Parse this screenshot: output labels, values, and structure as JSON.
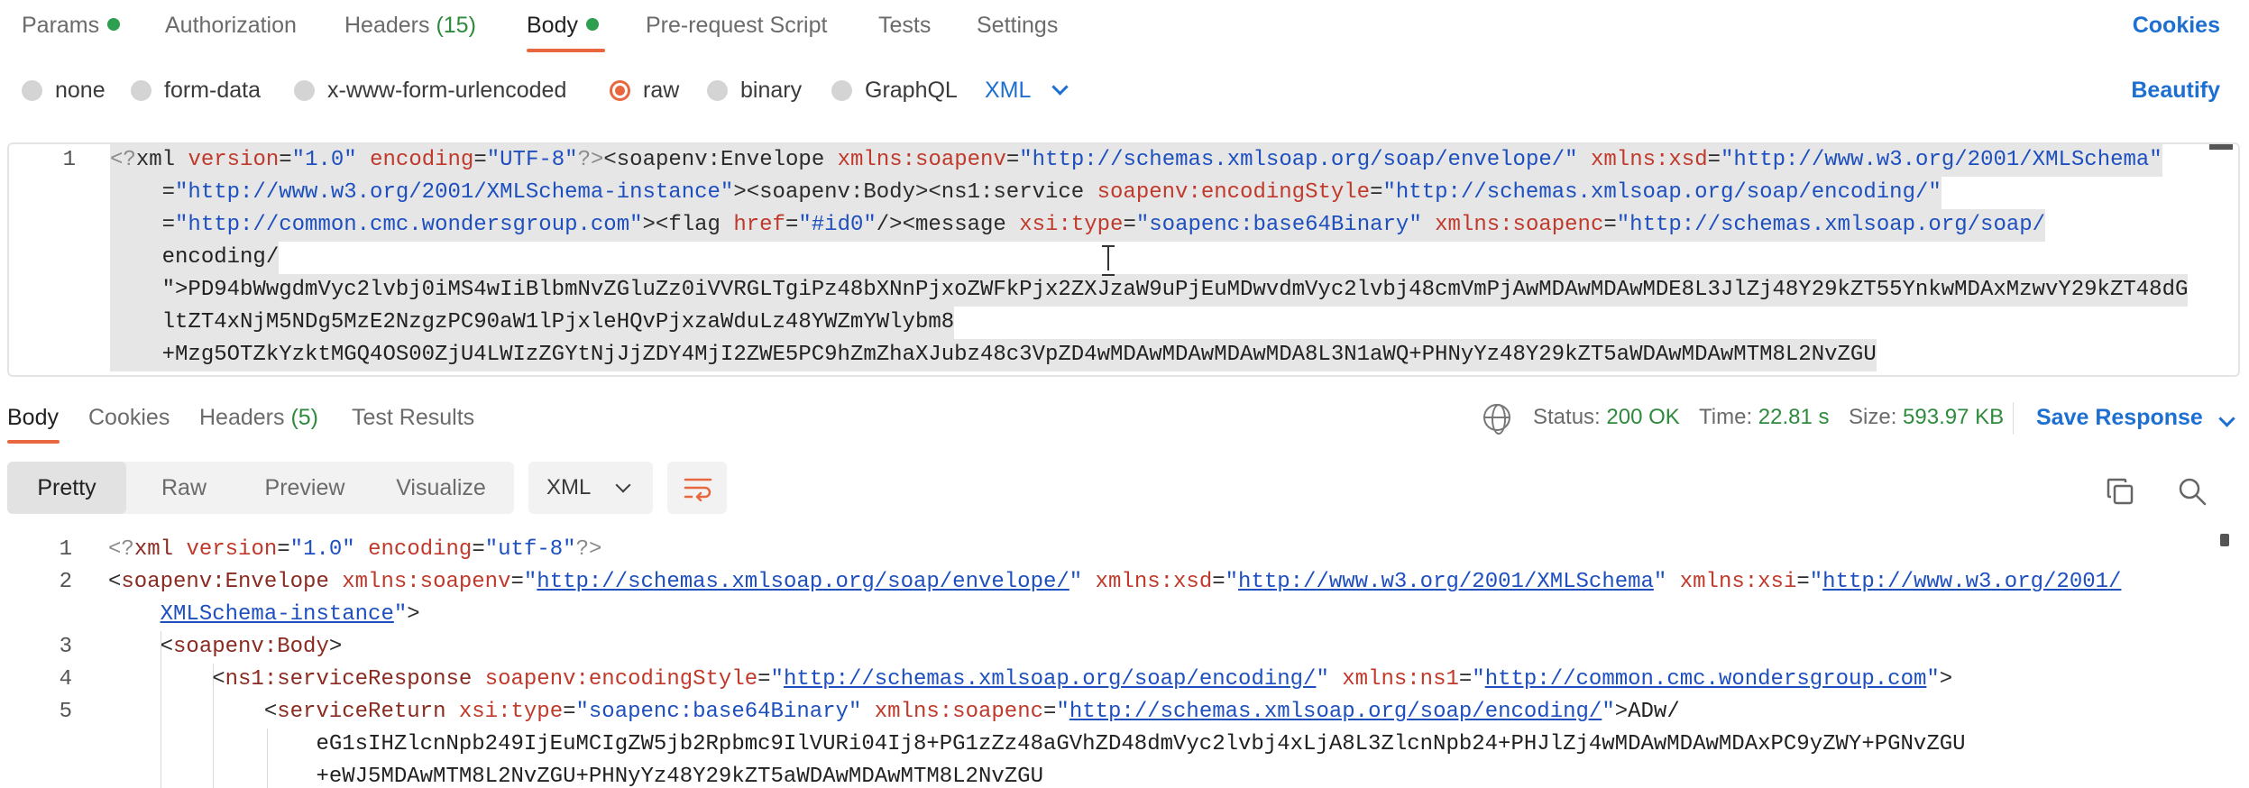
{
  "request_tabs": [
    {
      "label": "Params",
      "dot": true
    },
    {
      "label": "Authorization"
    },
    {
      "label": "Headers",
      "count": "(15)"
    },
    {
      "label": "Body",
      "dot": true,
      "active": true
    },
    {
      "label": "Pre-request Script"
    },
    {
      "label": "Tests"
    },
    {
      "label": "Settings"
    }
  ],
  "cookies_label": "Cookies",
  "body_types": [
    {
      "label": "none"
    },
    {
      "label": "form-data"
    },
    {
      "label": "x-www-form-urlencoded"
    },
    {
      "label": "raw",
      "selected": true
    },
    {
      "label": "binary"
    },
    {
      "label": "GraphQL"
    }
  ],
  "language_select": "XML",
  "beautify_label": "Beautify",
  "request_editor": {
    "line_number": "1",
    "lines": [
      "<?xml version=\"1.0\" encoding=\"UTF-8\"?><soapenv:Envelope xmlns:soapenv=\"http://schemas.xmlsoap.org/soap/envelope/\" xmlns:xsd=\"http://www.w3.org/2001/XMLSchema\"",
      "    xmlns:xsi=\"http://www.w3.org/2001/XMLSchema-instance\"><soapenv:Body><ns1:service soapenv:encodingStyle=\"http://schemas.xmlsoap.org/soap/encoding/\"",
      "    xmlns:ns1=\"http://common.cmc.wondersgroup.com\"><flag href=\"#id0\"/><message xsi:type=\"soapenc:base64Binary\" xmlns:soapenc=\"http://schemas.xmlsoap.org/soap/",
      "    encoding/",
      "    \">PD94bWwgdmVyc2lvbj0iMS4wIiBlbmNvZGluZz0iVVRGLTgiPz48bXNnPjxoZWFkPjx2ZXJzaW9uPjEuMDwvdmVyc2lvbj48cmVmPjAwMDAwMDAwMDE8L3JlZj48Y29kZT55YnkwMDAxMzwvY29kZT48dG",
      "    ltZT4xNjM5NDg5MzE2NzgzPC90aW1lPjxleHQvPjxzaWduLz48YWZmYWlybm8",
      "    +Mzg5OTZkYzktMGQ4OS00ZjU4LWIzZGYtNjJjZDY4MjI2ZWE5PC9hZmZhaXJubz48c3VpZD4wMDAwMDAwMDAwMDA8L3N1aWQ+PHNyYz48Y29kZT5aWDAwMDAwMTM8L2NvZGU"
    ]
  },
  "response_tabs": [
    {
      "label": "Body",
      "active": true
    },
    {
      "label": "Cookies"
    },
    {
      "label": "Headers",
      "count": "(5)"
    },
    {
      "label": "Test Results"
    }
  ],
  "response_meta": {
    "status_label": "Status:",
    "status_value": "200 OK",
    "time_label": "Time:",
    "time_value": "22.81 s",
    "size_label": "Size:",
    "size_value": "593.97 KB"
  },
  "save_response_label": "Save Response",
  "view_modes": [
    {
      "label": "Pretty",
      "active": true
    },
    {
      "label": "Raw"
    },
    {
      "label": "Preview"
    },
    {
      "label": "Visualize"
    }
  ],
  "format_select": "XML",
  "response_editor": {
    "line_numbers": [
      "1",
      "2",
      "",
      "3",
      "4",
      "5",
      "",
      ""
    ],
    "lines": [
      "<?xml version=\"1.0\" encoding=\"utf-8\"?>",
      "<soapenv:Envelope xmlns:soapenv=\"http://schemas.xmlsoap.org/soap/envelope/\" xmlns:xsd=\"http://www.w3.org/2001/XMLSchema\" xmlns:xsi=\"http://www.w3.org/2001/",
      "    XMLSchema-instance\">",
      "    <soapenv:Body>",
      "        <ns1:serviceResponse soapenv:encodingStyle=\"http://schemas.xmlsoap.org/soap/encoding/\" xmlns:ns1=\"http://common.cmc.wondersgroup.com\">",
      "            <serviceReturn xsi:type=\"soapenc:base64Binary\" xmlns:soapenc=\"http://schemas.xmlsoap.org/soap/encoding/\">ADw/",
      "                eG1sIHZlcnNpb249IjEuMCIgZW5jb2Rpbmc9IlVURi04Ij8+PG1zZz48aGVhZD48dmVyc2lvbj4xLjA8L3ZlcnNpb24+PHJlZj4wMDAwMDAwMDAxPC9yZWY+PGNvZGU",
      "                +eWJ5MDAwMTM8L2NvZGU+PHNyYz48Y29kZT5aWDAwMDAwMTM8L2NvZGU"
    ]
  },
  "colors": {
    "accent": "#e8673f",
    "link": "#1d6fd1",
    "success": "#2e8b3d"
  }
}
